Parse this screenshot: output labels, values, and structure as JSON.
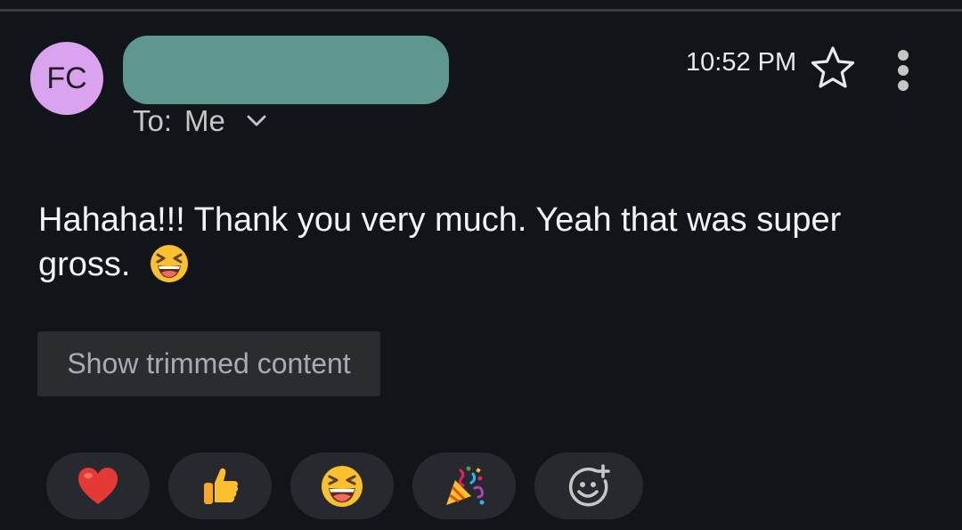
{
  "sender": {
    "initials": "FC",
    "avatar_color": "#d9a3ef",
    "name_redacted": true,
    "redaction_color": "#5f968d"
  },
  "recipient": {
    "to_label": "To:",
    "to_value": "Me"
  },
  "header": {
    "time": "10:52 PM"
  },
  "message": {
    "body": "Hahaha!!! Thank you very much. Yeah that was super gross."
  },
  "actions": {
    "show_trimmed_label": "Show trimmed content"
  },
  "reactions": [
    {
      "icon": "red-heart-emoji"
    },
    {
      "icon": "thumbs-up-emoji"
    },
    {
      "icon": "laughing-face-emoji"
    },
    {
      "icon": "party-popper-emoji"
    },
    {
      "icon": "add-reaction-icon"
    }
  ],
  "colors": {
    "background": "#111418",
    "chip": "#26292e",
    "trim_button": "#2a2c30"
  }
}
